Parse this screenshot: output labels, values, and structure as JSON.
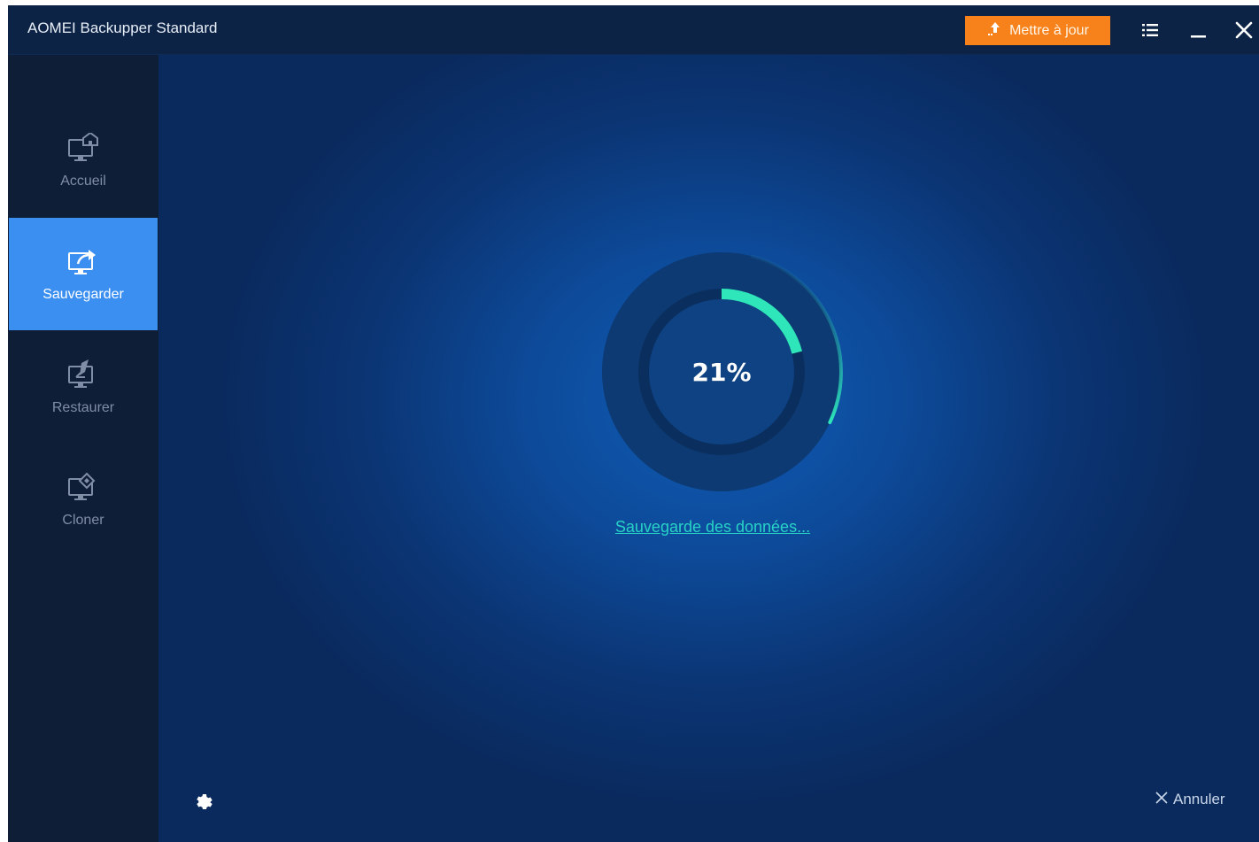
{
  "window": {
    "title": "AOMEI Backupper Standard",
    "update_label": "Mettre à jour"
  },
  "sidebar": {
    "items": [
      {
        "label": "Accueil",
        "icon": "home-monitor-icon",
        "active": false
      },
      {
        "label": "Sauvegarder",
        "icon": "backup-monitor-icon",
        "active": true
      },
      {
        "label": "Restaurer",
        "icon": "restore-monitor-icon",
        "active": false
      },
      {
        "label": "Cloner",
        "icon": "clone-monitor-icon",
        "active": false
      }
    ]
  },
  "progress": {
    "value": 0.21,
    "label": "21%",
    "status": "Sauvegarde des données..."
  },
  "footer": {
    "cancel_label": "Annuler"
  },
  "colors": {
    "accent": "#f7821b",
    "active_nav": "#3b8ff1",
    "progress": "#2ee6b9",
    "status_link": "#27d3c6"
  }
}
